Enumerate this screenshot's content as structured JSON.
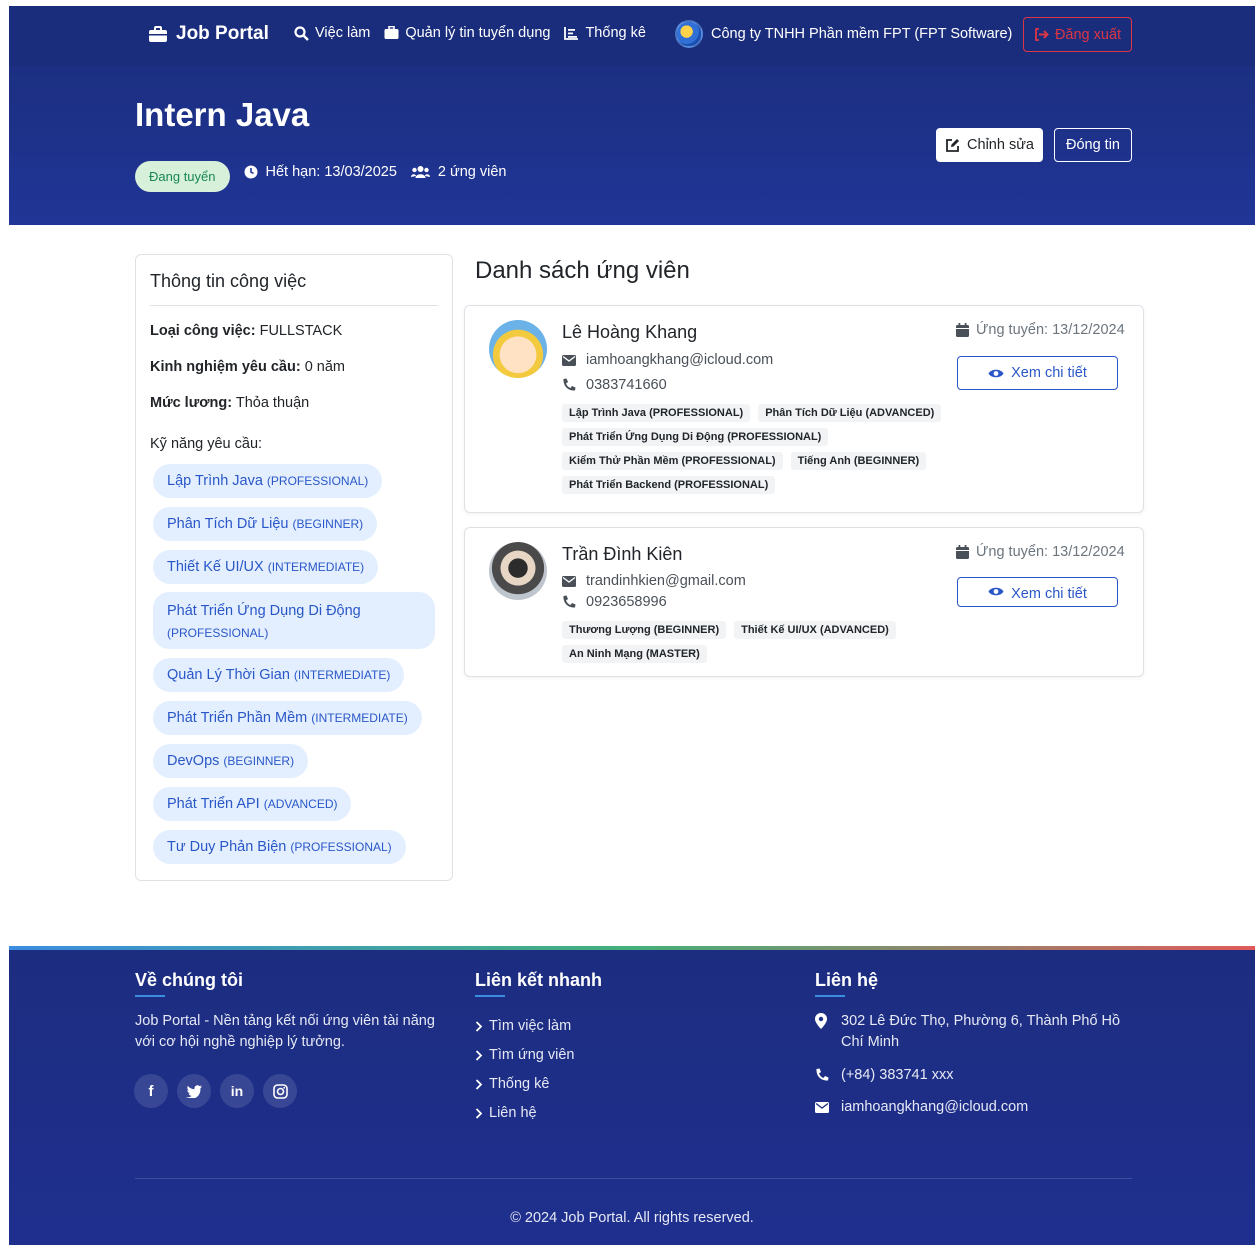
{
  "nav": {
    "brand": "Job Portal",
    "links": [
      "Việc làm",
      "Quản lý tin tuyển dụng",
      "Thống kê"
    ],
    "company": "Công ty TNHH Phần mềm FPT (FPT Software)",
    "logout": "Đăng xuất"
  },
  "job": {
    "title": "Intern Java",
    "status": "Đang tuyển",
    "deadline": "Hết hạn: 13/03/2025",
    "applicants": "2 ứng viên",
    "edit_label": "Chỉnh sửa",
    "close_label": "Đóng tin"
  },
  "info": {
    "title": "Thông tin công việc",
    "type_label": "Loại công việc:",
    "type_value": "FULLSTACK",
    "exp_label": "Kinh nghiệm yêu cầu:",
    "exp_value": "0 năm",
    "salary_label": "Mức lương:",
    "salary_value": "Thỏa thuận",
    "skills_label": "Kỹ năng yêu cầu:",
    "skills": [
      {
        "name": "Lập Trình Java",
        "level": "(PROFESSIONAL)"
      },
      {
        "name": "Phân Tích Dữ Liệu",
        "level": "(BEGINNER)"
      },
      {
        "name": "Thiết Kế UI/UX",
        "level": "(INTERMEDIATE)"
      },
      {
        "name": "Phát Triển Ứng Dụng Di Động",
        "level": "(PROFESSIONAL)"
      },
      {
        "name": "Quản Lý Thời Gian",
        "level": "(INTERMEDIATE)"
      },
      {
        "name": "Phát Triển Phần Mềm",
        "level": "(INTERMEDIATE)"
      },
      {
        "name": "DevOps",
        "level": "(BEGINNER)"
      },
      {
        "name": "Phát Triển API",
        "level": "(ADVANCED)"
      },
      {
        "name": "Tư Duy Phản Biện",
        "level": "(PROFESSIONAL)"
      }
    ]
  },
  "applicants_title": "Danh sách ứng viên",
  "applicants": [
    {
      "name": "Lê Hoàng Khang",
      "email": "iamhoangkhang@icloud.com",
      "phone": "0383741660",
      "applied": "Ứng tuyển: 13/12/2024",
      "view_label": "Xem chi tiết",
      "tags": [
        "Lập Trình Java (PROFESSIONAL)",
        "Phân Tích Dữ Liệu (ADVANCED)",
        "Phát Triển Ứng Dụng Di Động (PROFESSIONAL)",
        "Kiểm Thử Phần Mềm (PROFESSIONAL)",
        "Tiếng Anh (BEGINNER)",
        "Phát Triển Backend (PROFESSIONAL)"
      ]
    },
    {
      "name": "Trần Đình Kiên",
      "email": "trandinhkien@gmail.com",
      "phone": "0923658996",
      "applied": "Ứng tuyển: 13/12/2024",
      "view_label": "Xem chi tiết",
      "tags": [
        "Thương Lượng (BEGINNER)",
        "Thiết Kế UI/UX (ADVANCED)",
        "An Ninh Mạng (MASTER)"
      ]
    }
  ],
  "footer": {
    "about_title": "Về chúng tôi",
    "about_text": "Job Portal - Nền tảng kết nối ứng viên tài năng với cơ hội nghề nghiệp lý tưởng.",
    "social": [
      "f",
      "in"
    ],
    "links_title": "Liên kết nhanh",
    "links": [
      "Tìm việc làm",
      "Tìm ứng viên",
      "Thống kê",
      "Liên hệ"
    ],
    "contact_title": "Liên hệ",
    "address": "302 Lê Đức Thọ, Phường 6, Thành Phố Hồ Chí Minh",
    "phone": "(+84) 383741 xxx",
    "email": "iamhoangkhang@icloud.com",
    "copyright": "© 2024 Job Portal. All rights reserved."
  }
}
